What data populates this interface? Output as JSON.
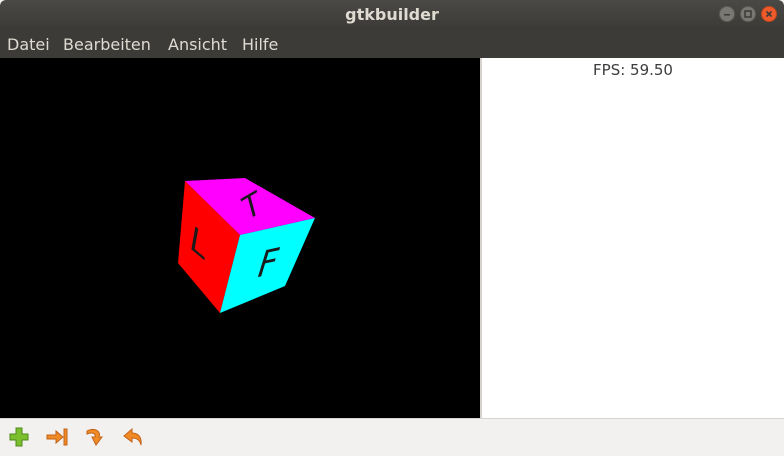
{
  "window": {
    "title": "gtkbuilder"
  },
  "menu": {
    "items": [
      "Datei",
      "Bearbeiten",
      "Ansicht",
      "Hilfe"
    ]
  },
  "scene": {
    "cube_faces": {
      "top": {
        "letter": "T",
        "color": "#ff00ff"
      },
      "left": {
        "letter": "L",
        "color": "#ff0000"
      },
      "front": {
        "letter": "F",
        "color": "#00ffff"
      }
    }
  },
  "status": {
    "fps_text": "FPS: 59.50"
  },
  "toolbar": {
    "icons": [
      "add-icon",
      "jump-to-icon",
      "redo-icon",
      "undo-icon"
    ]
  }
}
